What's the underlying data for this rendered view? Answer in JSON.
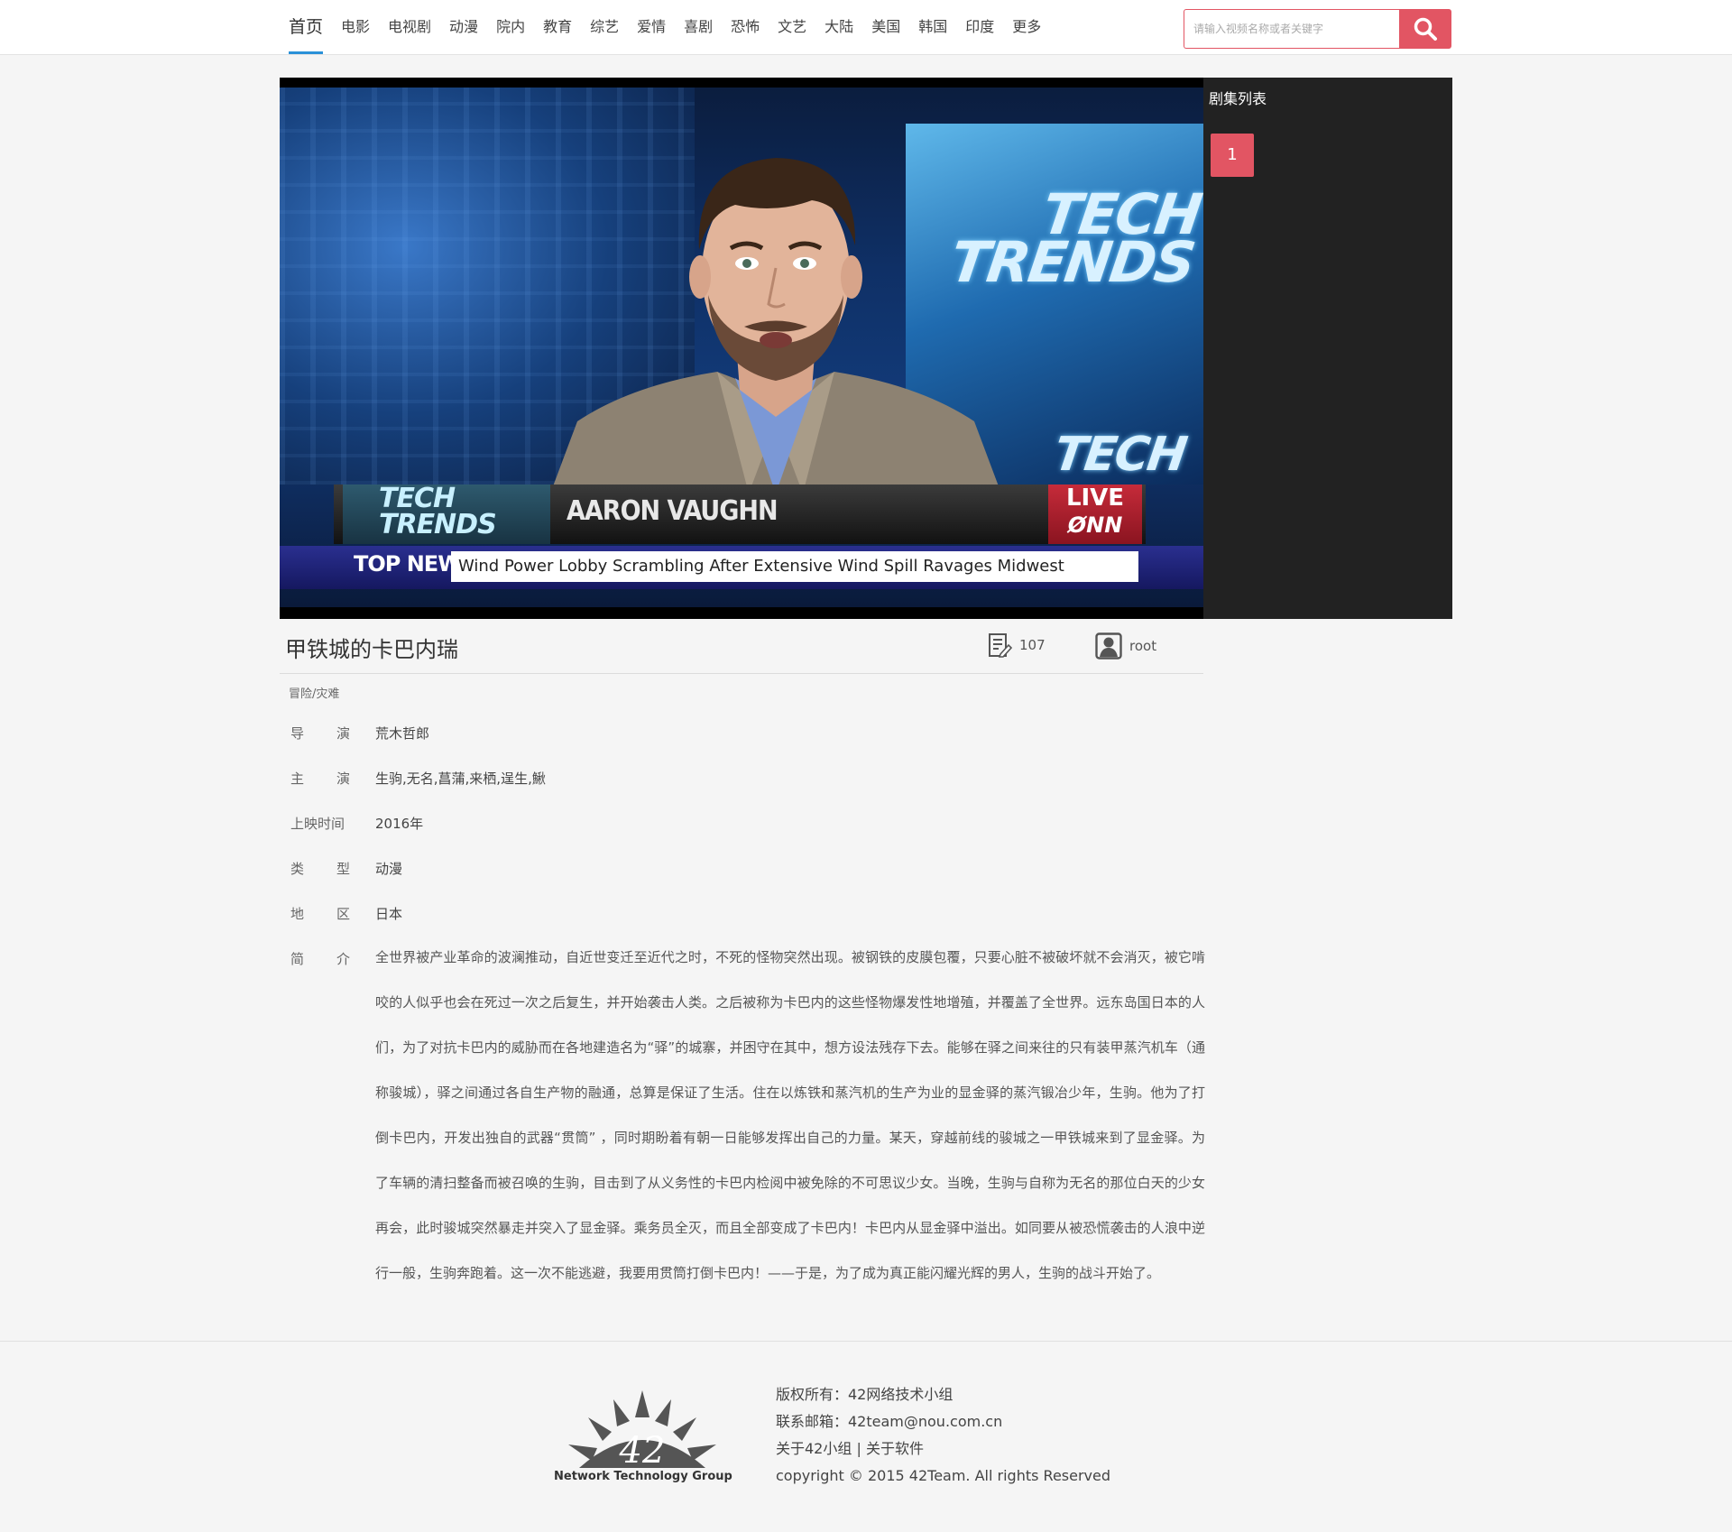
{
  "nav": {
    "items": [
      {
        "label": "首页",
        "active": true
      },
      {
        "label": "电影"
      },
      {
        "label": "电视剧"
      },
      {
        "label": "动漫"
      },
      {
        "label": "院内"
      },
      {
        "label": "教育"
      },
      {
        "label": "综艺"
      },
      {
        "label": "爱情"
      },
      {
        "label": "喜剧"
      },
      {
        "label": "恐怖"
      },
      {
        "label": "文艺"
      },
      {
        "label": "大陆"
      },
      {
        "label": "美国"
      },
      {
        "label": "韩国"
      },
      {
        "label": "印度"
      },
      {
        "label": "更多"
      }
    ]
  },
  "search": {
    "placeholder": "请输入视频名称或者关键字",
    "value": "",
    "icon": "search-icon",
    "accent": "#e25563"
  },
  "video": {
    "overlay": {
      "brand_line1": "TECH",
      "brand_line2": "TRENDS",
      "name": "AARON VAUGHN",
      "live": "LIVE",
      "network": "ØNN",
      "top_news": "TOP NEWS",
      "headline": "Wind Power Lobby Scrambling After Extensive Wind Spill Ravages Midwest"
    }
  },
  "episodes": {
    "title": "剧集列表",
    "items": [
      "1"
    ]
  },
  "info": {
    "title": "甲铁城的卡巴内瑞",
    "views": "107",
    "views_icon": "edit-document-icon",
    "user": "root",
    "user_icon": "user-icon",
    "genre": "冒险/灾难",
    "rows": [
      {
        "label": [
          "导",
          "演"
        ],
        "value": "荒木哲郎"
      },
      {
        "label": [
          "主",
          "演"
        ],
        "value": "生驹,无名,菖蒲,来栖,逞生,鰍"
      },
      {
        "label": [
          "上映时间"
        ],
        "value": "2016年"
      },
      {
        "label": [
          "类",
          "型"
        ],
        "value": "动漫"
      },
      {
        "label": [
          "地",
          "区"
        ],
        "value": "日本"
      }
    ],
    "synopsis_label": [
      "简",
      "介"
    ],
    "synopsis": "全世界被产业革命的波澜推动，自近世变迁至近代之时，不死的怪物突然出现。被钢铁的皮膜包覆，只要心脏不被破坏就不会消灭，被它啃咬的人似乎也会在死过一次之后复生，并开始袭击人类。之后被称为卡巴内的这些怪物爆发性地增殖，并覆盖了全世界。远东岛国日本的人们，为了对抗卡巴内的威胁而在各地建造名为“驿”的城寨，并困守在其中，想方设法残存下去。能够在驿之间来往的只有装甲蒸汽机车（通称骏城），驿之间通过各自生产物的融通，总算是保证了生活。住在以炼铁和蒸汽机的生产为业的显金驿的蒸汽锻冶少年，生驹。他为了打倒卡巴内，开发出独自的武器“贯筒” ，同时期盼着有朝一日能够发挥出自己的力量。某天，穿越前线的骏城之一甲铁城来到了显金驿。为了车辆的清扫整备而被召唤的生驹，目击到了从义务性的卡巴内检阅中被免除的不可思议少女。当晚，生驹与自称为无名的那位白天的少女再会，此时骏城突然暴走并突入了显金驿。乘务员全灭，而且全部变成了卡巴内！卡巴内从显金驿中溢出。如同要从被恐慌袭击的人浪中逆行一般，生驹奔跑着。这一次不能逃避，我要用贯筒打倒卡巴内！——于是，为了成为真正能闪耀光辉的男人，生驹的战斗开始了。"
  },
  "footer": {
    "logo_number": "42",
    "logo_caption": "Network Technology Group",
    "copyright_owner": "版权所有：42网络技术小组",
    "email": "联系邮箱：42team@nou.com.cn",
    "about_group": "关于42小组",
    "separator": "|",
    "about_software": "关于软件",
    "copyright": "copyright © 2015 42Team. All rights Reserved"
  }
}
